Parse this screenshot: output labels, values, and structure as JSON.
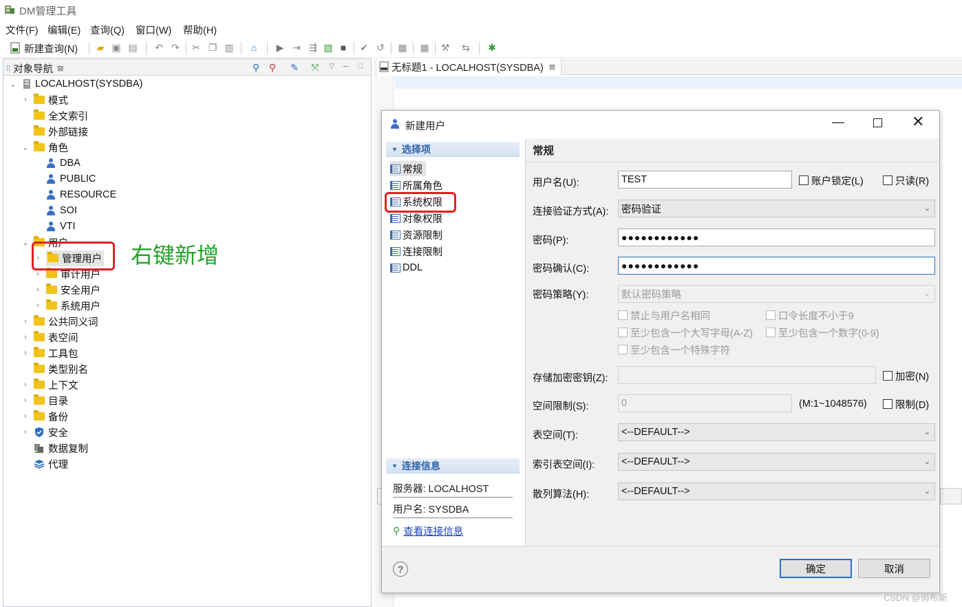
{
  "window": {
    "title": "DM管理工具"
  },
  "menu": [
    "文件(F)",
    "编辑(E)",
    "查询(Q)",
    "窗口(W)",
    "帮助(H)"
  ],
  "toolbar": {
    "new_query_label": "新建查询(N)"
  },
  "nav": {
    "tab_label": "对象导航",
    "server": "LOCALHOST(SYSDBA)",
    "items": {
      "schema": "模式",
      "fulltext": "全文索引",
      "dblink": "外部链接",
      "role": "角色",
      "dba": "DBA",
      "public": "PUBLIC",
      "resource": "RESOURCE",
      "soi": "SOI",
      "vti": "VTI",
      "user": "用户",
      "admin_user": "管理用户",
      "audit_user": "审计用户",
      "security_user": "安全用户",
      "system_user": "系统用户",
      "synonym": "公共同义词",
      "tablespace": "表空间",
      "package": "工具包",
      "type_alias": "类型别名",
      "context": "上下文",
      "directory": "目录",
      "backup": "备份",
      "security": "安全",
      "replication": "数据复制",
      "agent": "代理"
    }
  },
  "annotation": {
    "text": "右键新增",
    "color": "#22a22b"
  },
  "editor": {
    "tab_label": "无标题1 - LOCALHOST(SYSDBA)"
  },
  "dialog": {
    "title": "新建用户",
    "left": {
      "section_select": "选择项",
      "items": [
        "常规",
        "所属角色",
        "系统权限",
        "对象权限",
        "资源限制",
        "连接限制",
        "DDL"
      ],
      "section_conn": "连接信息",
      "server_info": "服务器: LOCALHOST",
      "user_info": "用户名: SYSDBA",
      "view_conn_link": "查看连接信息"
    },
    "right": {
      "heading": "常规",
      "username_label": "用户名(U):",
      "username_value": "TEST",
      "lock_label": "账户锁定(L)",
      "readonly_label": "只读(R)",
      "auth_label": "连接验证方式(A):",
      "auth_value": "密码验证",
      "password_label": "密码(P):",
      "password_value": "●●●●●●●●●●●●",
      "confirm_label": "密码确认(C):",
      "confirm_value": "●●●●●●●●●●●●",
      "policy_label": "密码策略(Y):",
      "policy_value": "默认密码策略",
      "policy_opts": {
        "no_same_name": "禁止与用户名相同",
        "min_len": "口令长度不小于9",
        "upper": "至少包含一个大写字母(A-Z)",
        "digit": "至少包含一个数字(0-9)",
        "special": "至少包含一个特殊字符"
      },
      "enc_key_label": "存储加密密钥(Z):",
      "encrypt_label": "加密(N)",
      "space_label": "空间限制(S):",
      "space_value": "0",
      "space_range": "(M:1~1048576)",
      "limit_label": "限制(D)",
      "tablespace_label": "表空间(T):",
      "tablespace_value": "<--DEFAULT-->",
      "index_ts_label": "索引表空间(I):",
      "index_ts_value": "<--DEFAULT-->",
      "hash_label": "散列算法(H):",
      "hash_value": "<--DEFAULT-->"
    },
    "ok_label": "确定",
    "cancel_label": "取消"
  },
  "watermark": "CSDN @俏布斯"
}
